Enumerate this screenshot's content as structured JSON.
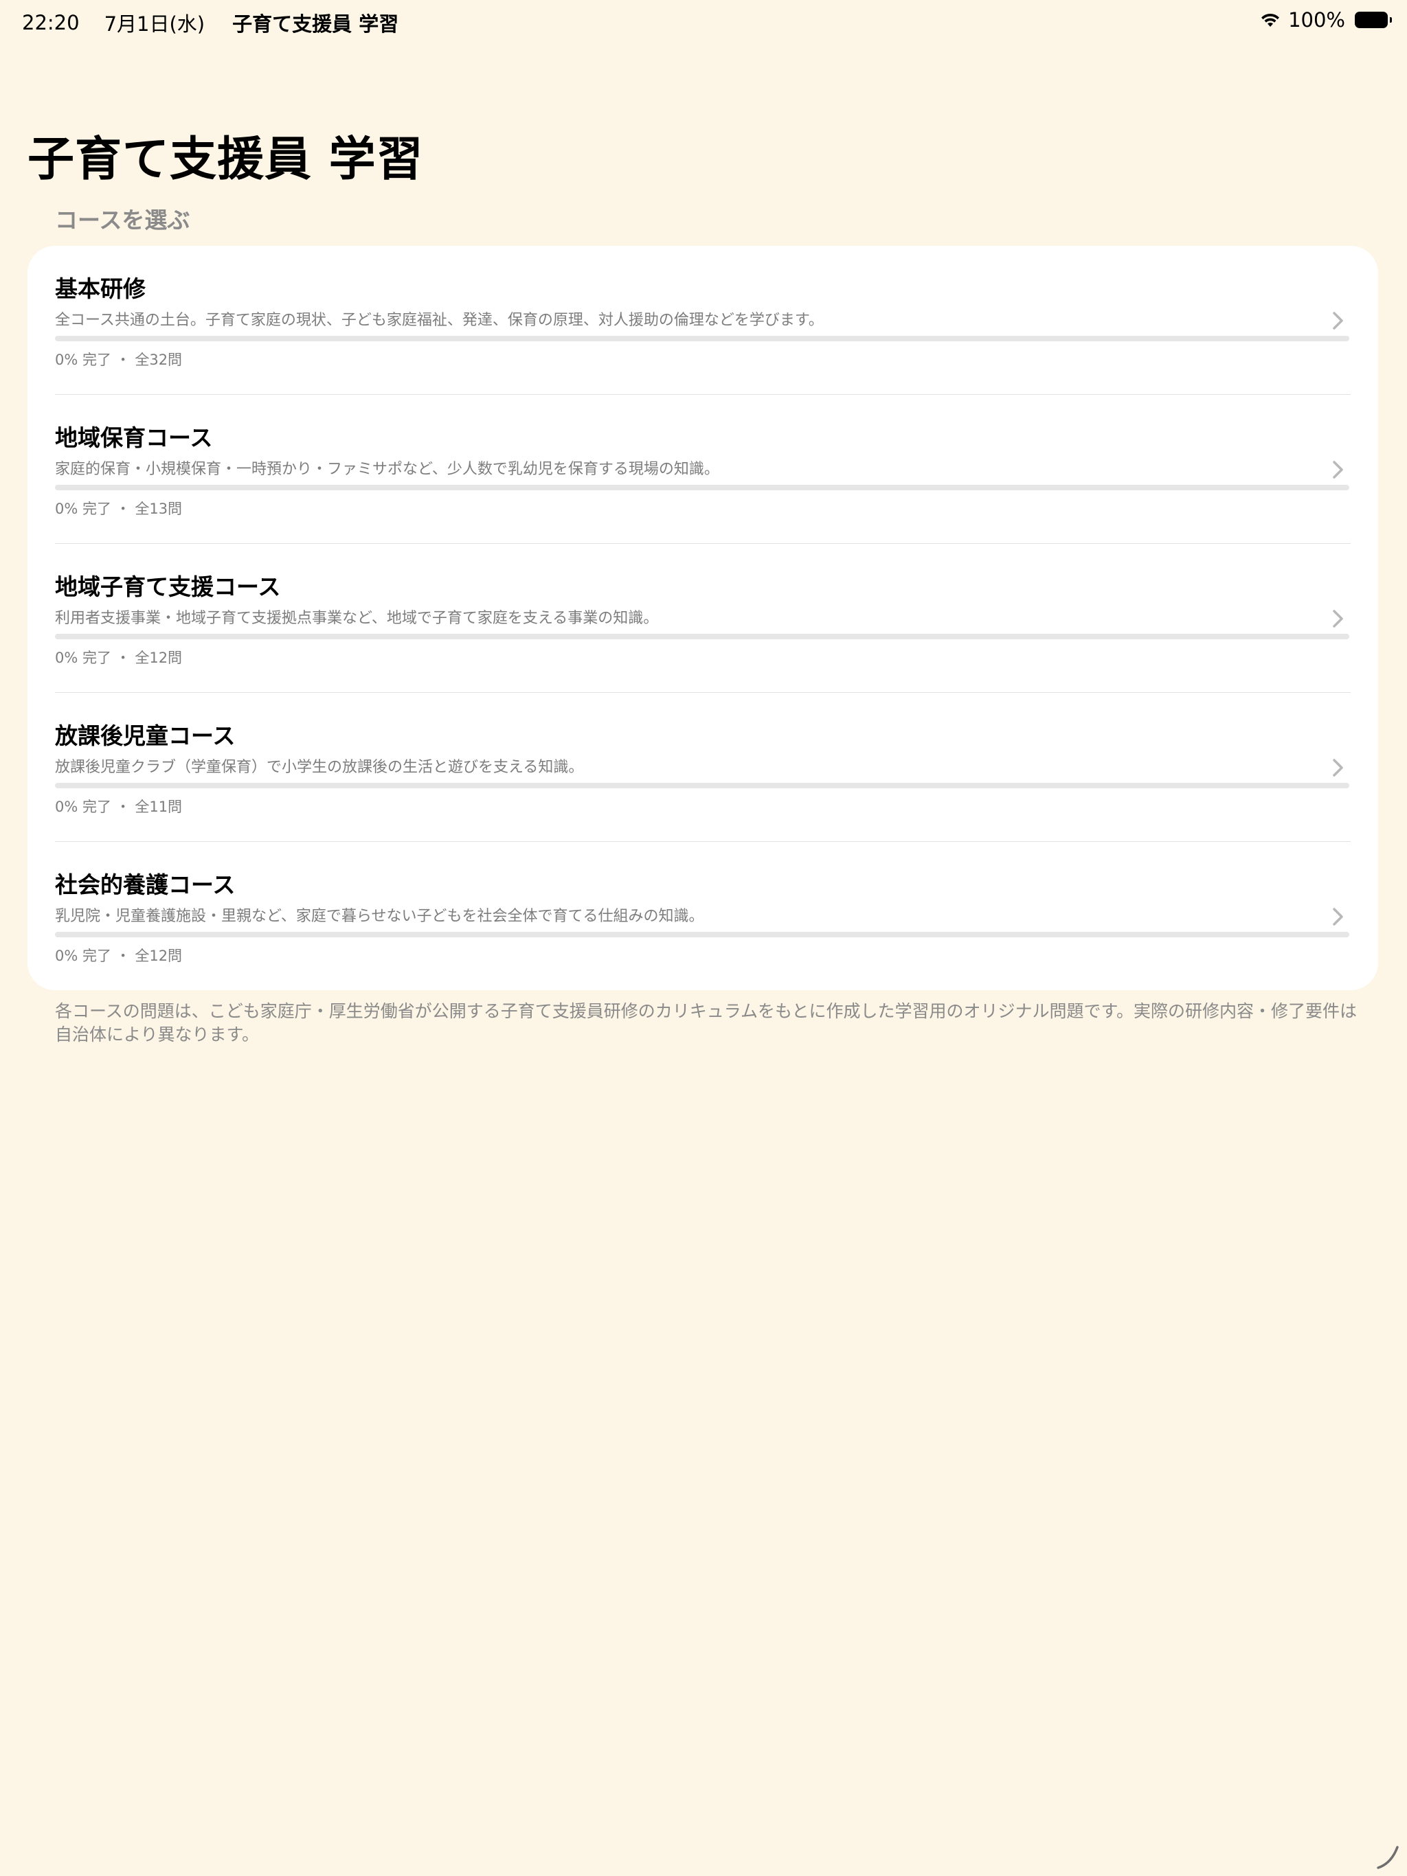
{
  "status_bar": {
    "time": "22:20",
    "date": "7月1日(水)",
    "app_name": "子育て支援員 学習",
    "battery": "100%",
    "wifi_icon": "wifi-icon",
    "battery_icon": "battery-icon"
  },
  "page": {
    "title": "子育て支援員 学習",
    "section_header": "コースを選ぶ",
    "footnote": "各コースの問題は、こども家庭庁・厚生労働省が公開する子育て支援員研修のカリキュラムをもとに作成した学習用のオリジナル問題です。実際の研修内容・修了要件は自治体により異なります。"
  },
  "colors": {
    "background": "#fdf6e6",
    "card": "#ffffff",
    "secondary_text": "#7d7d7d",
    "progress_track": "#e6e6e6"
  },
  "courses": [
    {
      "title": "基本研修",
      "description": "全コース共通の土台。子育て家庭の現状、子ども家庭福祉、発達、保育の原理、対人援助の倫理などを学びます。",
      "progress_percent": 0,
      "meta": "0% 完了 ・ 全32問"
    },
    {
      "title": "地域保育コース",
      "description": "家庭的保育・小規模保育・一時預かり・ファミサポなど、少人数で乳幼児を保育する現場の知識。",
      "progress_percent": 0,
      "meta": "0% 完了 ・ 全13問"
    },
    {
      "title": "地域子育て支援コース",
      "description": "利用者支援事業・地域子育て支援拠点事業など、地域で子育て家庭を支える事業の知識。",
      "progress_percent": 0,
      "meta": "0% 完了 ・ 全12問"
    },
    {
      "title": "放課後児童コース",
      "description": "放課後児童クラブ（学童保育）で小学生の放課後の生活と遊びを支える知識。",
      "progress_percent": 0,
      "meta": "0% 完了 ・ 全11問"
    },
    {
      "title": "社会的養護コース",
      "description": "乳児院・児童養護施設・里親など、家庭で暮らせない子どもを社会全体で育てる仕組みの知識。",
      "progress_percent": 0,
      "meta": "0% 完了 ・ 全12問"
    }
  ]
}
